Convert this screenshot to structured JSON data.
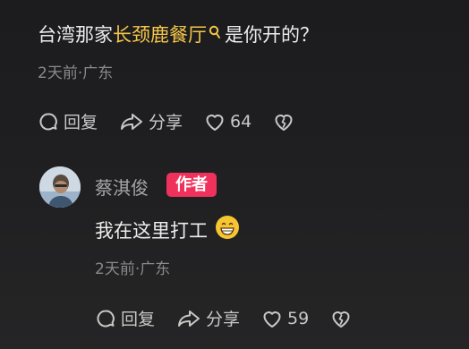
{
  "comment": {
    "text_before": "台湾那家",
    "keyword": "长颈鹿餐厅",
    "text_after": "是你开的？",
    "meta": "2天前·广东",
    "reply_label": "回复",
    "share_label": "分享",
    "like_count": "64"
  },
  "reply": {
    "username": "蔡淇俊",
    "badge": "作者",
    "text": "我在这里打工",
    "emoji": "grinning-face-emoji",
    "meta": "2天前·广东",
    "reply_label": "回复",
    "share_label": "分享",
    "like_count": "59"
  },
  "colors": {
    "background": "#1c1c1e",
    "keyword": "#f5c648",
    "author_badge": "#f0315b",
    "meta_text": "#8a8a8c"
  },
  "icons": [
    "search-icon",
    "reply-bubble-icon",
    "share-arrow-icon",
    "heart-icon",
    "broken-heart-icon",
    "avatar-icon"
  ]
}
